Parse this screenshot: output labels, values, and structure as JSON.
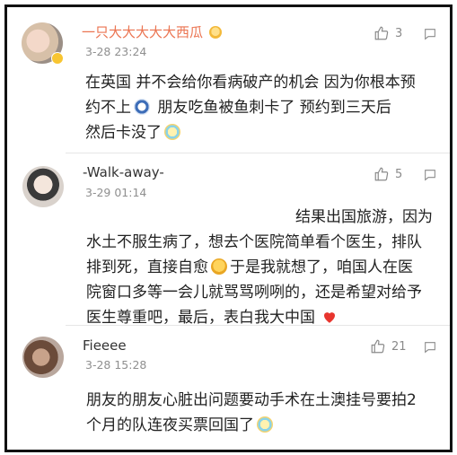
{
  "comments": [
    {
      "username": "一只大大大大大西瓜",
      "time": "3-28 23:24",
      "likes": "3",
      "lines": [
        "在英国 并不会给你看病破产的机会  因为你根本预",
        "约不上",
        "  朋友吃鱼被鱼刺卡了  预约到三天后",
        "然后卡没了"
      ]
    },
    {
      "username": "-Walk-away-",
      "time": "3-29 01:14",
      "likes": "5",
      "lines": [
        "结果出国旅游，因为",
        "水土不服生病了，想去个医院简单看个医生，排队",
        "排到死，直接自愈",
        "于是我就想了，咱国人在医",
        "院窗口多等一会儿就骂骂咧咧的，还是希望对给予",
        "医生尊重吧，最后，表白我大中国"
      ]
    },
    {
      "username": "Fieeee",
      "time": "3-28 15:28",
      "likes": "21",
      "lines": [
        "朋友的朋友心脏出问题要动手术在土澳挂号要拍2",
        "个月的队连夜买票回国了"
      ]
    }
  ],
  "icons": {
    "like": "thumbs-up-icon",
    "reply": "reply-icon",
    "vip": "vip-badge-icon"
  },
  "colors": {
    "vip_name": "#eb7350",
    "name": "#333333",
    "meta": "#8f8f8f",
    "text": "#222222",
    "heart": "#e8352e"
  }
}
